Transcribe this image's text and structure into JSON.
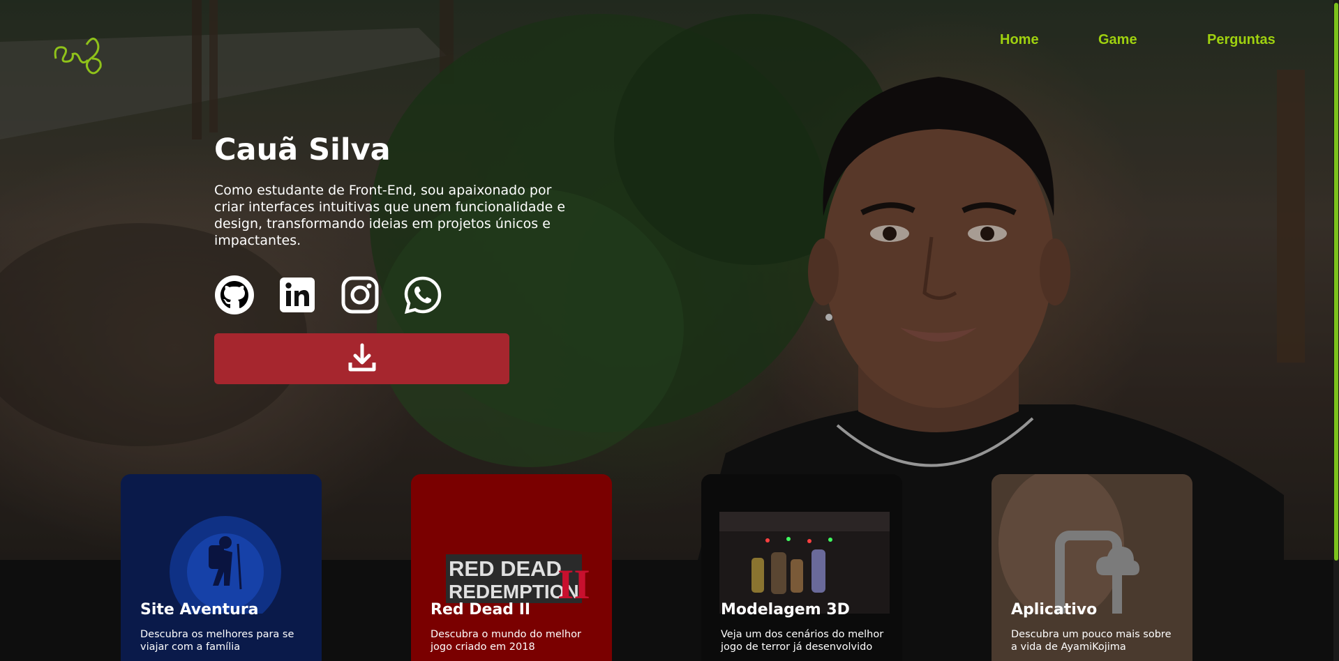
{
  "header": {
    "logo_icon": "signature-logo-icon",
    "nav": [
      {
        "label": "Home"
      },
      {
        "label": "Game"
      },
      {
        "label": "Perguntas"
      }
    ],
    "accent_color": "#9fd10f"
  },
  "hero": {
    "name": "Cauã Silva",
    "description": "Como estudante de Front-End, sou apaixonado por criar interfaces intuitivas que unem funcionalidade e design, transformando ideias em projetos únicos e impactantes.",
    "socials": [
      {
        "icon": "github-icon"
      },
      {
        "icon": "linkedin-icon"
      },
      {
        "icon": "instagram-icon"
      },
      {
        "icon": "whatsapp-icon"
      }
    ],
    "download_button": {
      "icon": "download-icon",
      "color": "#a6262e"
    }
  },
  "cards": [
    {
      "title": "Site Aventura",
      "description": "Descubra os melhores para se viajar com a família",
      "color": "#0a1a4a"
    },
    {
      "title": "Red Dead II",
      "description": "Descubra o mundo do melhor jogo criado em 2018",
      "color": "#7a0000",
      "logo_text_1": "RED DEAD",
      "logo_text_2": "REDEMPTION",
      "logo_text_3": "II"
    },
    {
      "title": "Modelagem 3D",
      "description": "Veja um dos cenários do melhor jogo de terror já desenvolvido",
      "color": "#0b0b0b"
    },
    {
      "title": "Aplicativo",
      "description": "Descubra um pouco mais sobre a vida de AyamiKojima",
      "color": "#4a3a2e"
    }
  ]
}
